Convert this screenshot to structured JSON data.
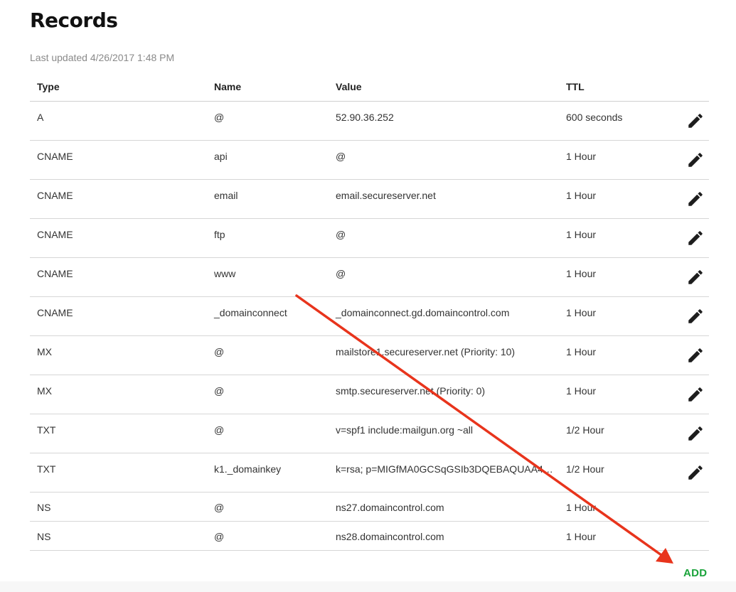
{
  "page": {
    "title": "Records",
    "last_updated": "Last updated 4/26/2017 1:48 PM"
  },
  "table": {
    "headers": {
      "type": "Type",
      "name": "Name",
      "value": "Value",
      "ttl": "TTL"
    },
    "rows": [
      {
        "type": "A",
        "name": "@",
        "value": "52.90.36.252",
        "ttl": "600 seconds",
        "editable": true
      },
      {
        "type": "CNAME",
        "name": "api",
        "value": "@",
        "ttl": "1 Hour",
        "editable": true
      },
      {
        "type": "CNAME",
        "name": "email",
        "value": "email.secureserver.net",
        "ttl": "1 Hour",
        "editable": true
      },
      {
        "type": "CNAME",
        "name": "ftp",
        "value": "@",
        "ttl": "1 Hour",
        "editable": true
      },
      {
        "type": "CNAME",
        "name": "www",
        "value": "@",
        "ttl": "1 Hour",
        "editable": true
      },
      {
        "type": "CNAME",
        "name": "_domainconnect",
        "value": "_domainconnect.gd.domaincontrol.com",
        "ttl": "1 Hour",
        "editable": true
      },
      {
        "type": "MX",
        "name": "@",
        "value": "mailstore1.secureserver.net (Priority: 10)",
        "ttl": "1 Hour",
        "editable": true
      },
      {
        "type": "MX",
        "name": "@",
        "value": "smtp.secureserver.net (Priority: 0)",
        "ttl": "1 Hour",
        "editable": true
      },
      {
        "type": "TXT",
        "name": "@",
        "value": "v=spf1 include:mailgun.org ~all",
        "ttl": "1/2 Hour",
        "editable": true
      },
      {
        "type": "TXT",
        "name": "k1._domainkey",
        "value": "k=rsa; p=MIGfMA0GCSqGSIb3DQEBAQUAA4…",
        "ttl": "1/2 Hour",
        "editable": true
      },
      {
        "type": "NS",
        "name": "@",
        "value": "ns27.domaincontrol.com",
        "ttl": "1 Hour",
        "editable": false
      },
      {
        "type": "NS",
        "name": "@",
        "value": "ns28.domaincontrol.com",
        "ttl": "1 Hour",
        "editable": false
      }
    ]
  },
  "actions": {
    "add_label": "ADD",
    "edit_icon": "pencil-icon"
  },
  "colors": {
    "accent_green": "#1aa33b",
    "annotation_arrow": "#e8341c"
  }
}
